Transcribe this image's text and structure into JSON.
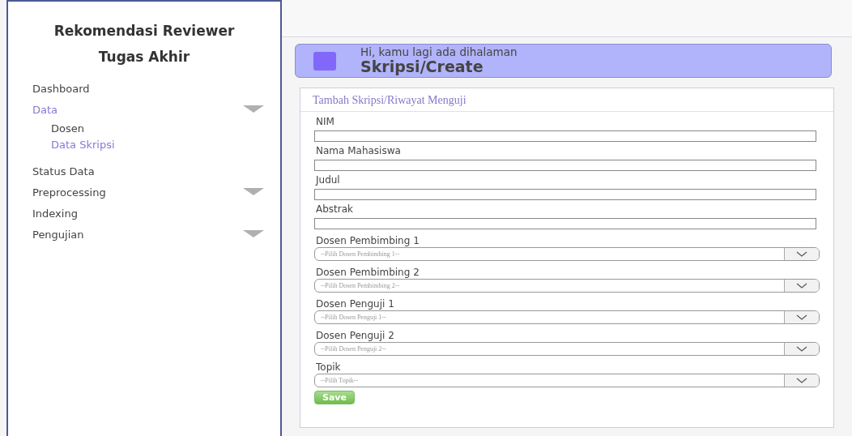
{
  "sidebar": {
    "title": "Rekomendasi Reviewer Tugas Akhir",
    "items": [
      {
        "label": "Dashboard",
        "kind": "link",
        "selected": false
      },
      {
        "label": "Data",
        "kind": "group",
        "selected": true,
        "children": [
          {
            "label": "Dosen",
            "selected": false
          },
          {
            "label": "Data Skripsi",
            "selected": true
          }
        ]
      },
      {
        "label": "Status Data",
        "kind": "link",
        "selected": false
      },
      {
        "label": "Preprocessing",
        "kind": "group",
        "selected": false
      },
      {
        "label": "Indexing",
        "kind": "link",
        "selected": false
      },
      {
        "label": "Pengujian",
        "kind": "group",
        "selected": false
      }
    ]
  },
  "banner": {
    "greeting": "Hi, kamu lagi ada  dihalaman",
    "page": "Skripsi/Create"
  },
  "form": {
    "title": "Tambah Skripsi/Riwayat Menguji",
    "fields": [
      {
        "label": "NIM",
        "kind": "text"
      },
      {
        "label": "Nama Mahasiswa",
        "kind": "text"
      },
      {
        "label": "Judul",
        "kind": "text"
      },
      {
        "label": "Abstrak",
        "kind": "text"
      },
      {
        "label": "Dosen Pembimbing 1",
        "kind": "select",
        "placeholder": "--Pilih Dosen Pembimbing 1--"
      },
      {
        "label": "Dosen Pembimbing 2",
        "kind": "select",
        "placeholder": "--Pilih Dosen Pembimbing 2--"
      },
      {
        "label": "Dosen Penguji 1",
        "kind": "select",
        "placeholder": "--Pilih Dosen Penguji 1--"
      },
      {
        "label": "Dosen Penguji 2",
        "kind": "select",
        "placeholder": "--Pilih Dosen Penguji 2--"
      },
      {
        "label": "Topik",
        "kind": "select",
        "placeholder": "--Pilih Topik--"
      }
    ],
    "button": "Save"
  }
}
